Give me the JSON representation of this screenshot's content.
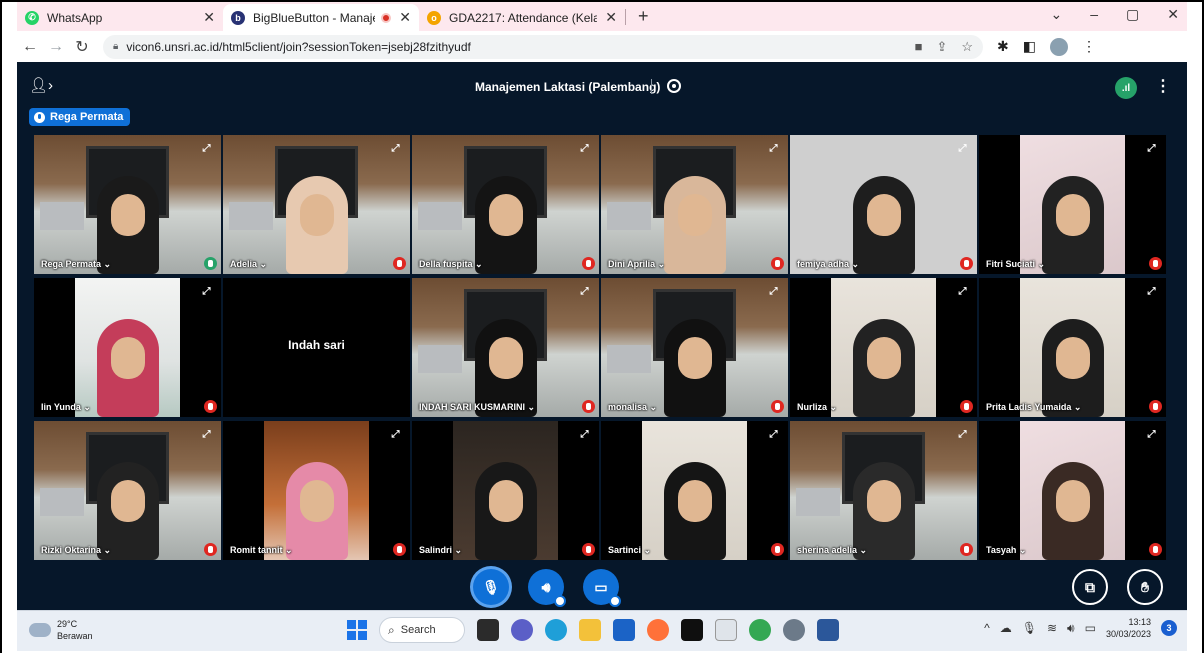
{
  "browser": {
    "tabs": [
      {
        "title": "WhatsApp",
        "active": false
      },
      {
        "title": "BigBlueButton - Manajemen",
        "active": true
      },
      {
        "title": "GDA2217: Attendance (Kelas Pale",
        "active": false
      }
    ],
    "new_tab": "+",
    "url": "vicon6.unsri.ac.id/html5client/join?sessionToken=jsebj28fzithyudf",
    "window_controls": {
      "minimize": "–",
      "restore": "▢",
      "close": "✕"
    }
  },
  "meeting": {
    "title": "Manajemen Laktasi (Palembang)",
    "talking_indicator": "Rega Permata",
    "connection_icon": "signal-icon",
    "accent_color": "#0f70d7",
    "background_color": "#06172a"
  },
  "participants": [
    {
      "name": "Rega Permata ⌄",
      "scene": "cafe",
      "talking": true,
      "muted": false
    },
    {
      "name": "Adelia ⌄",
      "scene": "cafe",
      "talking": false,
      "muted": true
    },
    {
      "name": "Della fuspita ⌄",
      "scene": "cafe",
      "talking": false,
      "muted": true
    },
    {
      "name": "Dini Aprilia ⌄",
      "scene": "cafe",
      "talking": false,
      "muted": true
    },
    {
      "name": "femiya adha ⌄",
      "scene": "plain",
      "talking": false,
      "muted": true
    },
    {
      "name": "Fitri Suciati ⌄",
      "scene": "pink",
      "talking": false,
      "muted": true
    },
    {
      "name": "Iin Yunda ⌄",
      "scene": "room",
      "talking": false,
      "muted": true
    },
    {
      "name": "Indah sari",
      "scene": "black",
      "talking": false,
      "muted": false,
      "no_video": true
    },
    {
      "name": "INDAH SARI KUSMARINI ⌄",
      "scene": "cafe",
      "talking": false,
      "muted": true
    },
    {
      "name": "monalisa ⌄",
      "scene": "cafe",
      "talking": false,
      "muted": true
    },
    {
      "name": "Nurliza ⌄",
      "scene": "wall",
      "talking": false,
      "muted": true
    },
    {
      "name": "Prita Ladis Yumaida ⌄",
      "scene": "wall",
      "talking": false,
      "muted": true
    },
    {
      "name": "Rizki Oktarina ⌄",
      "scene": "cafe",
      "talking": false,
      "muted": true
    },
    {
      "name": "Romit tannit ⌄",
      "scene": "orange",
      "talking": false,
      "muted": true
    },
    {
      "name": "Salindri ⌄",
      "scene": "dark",
      "talking": false,
      "muted": true
    },
    {
      "name": "Sartinci ⌄",
      "scene": "wall",
      "talking": false,
      "muted": true
    },
    {
      "name": "sherina adelia ⌄",
      "scene": "cafe",
      "talking": false,
      "muted": true
    },
    {
      "name": "Tasyah ⌄",
      "scene": "pink",
      "talking": false,
      "muted": true
    }
  ],
  "taskbar": {
    "weather_temp": "29°C",
    "weather_desc": "Berawan",
    "search_label": "Search",
    "time": "13:13",
    "date": "30/03/2023",
    "notification_count": "3"
  }
}
